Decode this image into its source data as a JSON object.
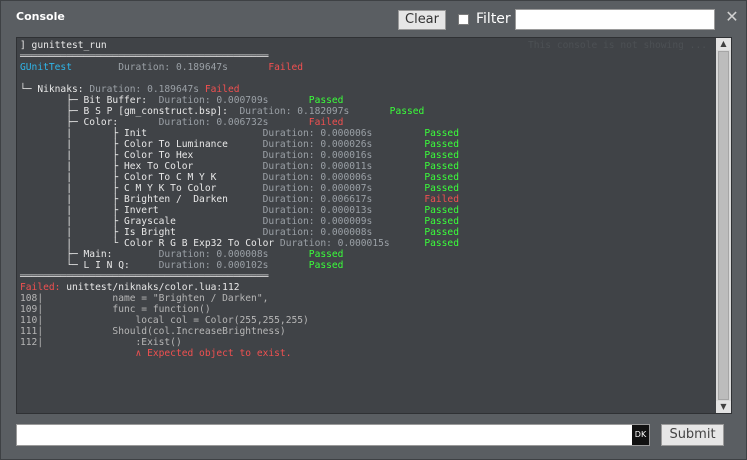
{
  "window": {
    "title": "Console",
    "close_glyph": "✕"
  },
  "toolbar": {
    "clear_label": "Clear",
    "filter_label": "Filter",
    "filter_value": "",
    "filter_checked": false
  },
  "console": {
    "ghost_text": "This console is not showing ...",
    "lines": [
      [
        {
          "t": "] gunittest_run",
          "c": "white"
        }
      ],
      [
        {
          "t": "═══════════════════════════════════════════",
          "c": "sep"
        }
      ],
      [
        {
          "t": "GUnitTest",
          "c": "cyan"
        },
        {
          "t": "        Duration: 0.189647s",
          "c": "gray"
        },
        {
          "t": "       Failed",
          "c": "failed"
        }
      ],
      [
        {
          "t": "",
          "c": "white"
        }
      ],
      [
        {
          "t": "└─ Niknaks: ",
          "c": "white"
        },
        {
          "t": "Duration: 0.189647s ",
          "c": "gray"
        },
        {
          "t": "Failed",
          "c": "failed"
        }
      ],
      [
        {
          "t": "        ├─ Bit Buffer:  ",
          "c": "white"
        },
        {
          "t": "Duration: 0.000709s",
          "c": "gray"
        },
        {
          "t": "       Passed",
          "c": "passed"
        }
      ],
      [
        {
          "t": "        ├─ B S P [gm_construct.bsp]:  ",
          "c": "white"
        },
        {
          "t": "Duration: 0.182097s",
          "c": "gray"
        },
        {
          "t": "       Passed",
          "c": "passed"
        }
      ],
      [
        {
          "t": "        ├─ Color:       ",
          "c": "white"
        },
        {
          "t": "Duration: 0.006732s",
          "c": "gray"
        },
        {
          "t": "       Failed",
          "c": "failed"
        }
      ],
      [
        {
          "t": "        |       ├ Init                    ",
          "c": "white"
        },
        {
          "t": "Duration: 0.000006s",
          "c": "gray"
        },
        {
          "t": "         Passed",
          "c": "passed"
        }
      ],
      [
        {
          "t": "        |       ├ Color To Luminance      ",
          "c": "white"
        },
        {
          "t": "Duration: 0.000026s",
          "c": "gray"
        },
        {
          "t": "         Passed",
          "c": "passed"
        }
      ],
      [
        {
          "t": "        |       ├ Color To Hex            ",
          "c": "white"
        },
        {
          "t": "Duration: 0.000016s",
          "c": "gray"
        },
        {
          "t": "         Passed",
          "c": "passed"
        }
      ],
      [
        {
          "t": "        |       ├ Hex To Color            ",
          "c": "white"
        },
        {
          "t": "Duration: 0.000011s",
          "c": "gray"
        },
        {
          "t": "         Passed",
          "c": "passed"
        }
      ],
      [
        {
          "t": "        |       ├ Color To C M Y K        ",
          "c": "white"
        },
        {
          "t": "Duration: 0.000006s",
          "c": "gray"
        },
        {
          "t": "         Passed",
          "c": "passed"
        }
      ],
      [
        {
          "t": "        |       ├ C M Y K To Color        ",
          "c": "white"
        },
        {
          "t": "Duration: 0.000007s",
          "c": "gray"
        },
        {
          "t": "         Passed",
          "c": "passed"
        }
      ],
      [
        {
          "t": "        |       ├ Brighten /  Darken      ",
          "c": "white"
        },
        {
          "t": "Duration: 0.006617s",
          "c": "gray"
        },
        {
          "t": "         Failed",
          "c": "failed"
        }
      ],
      [
        {
          "t": "        |       ├ Invert                  ",
          "c": "white"
        },
        {
          "t": "Duration: 0.000013s",
          "c": "gray"
        },
        {
          "t": "         Passed",
          "c": "passed"
        }
      ],
      [
        {
          "t": "        |       ├ Grayscale               ",
          "c": "white"
        },
        {
          "t": "Duration: 0.000009s",
          "c": "gray"
        },
        {
          "t": "         Passed",
          "c": "passed"
        }
      ],
      [
        {
          "t": "        |       ├ Is Bright               ",
          "c": "white"
        },
        {
          "t": "Duration: 0.000008s",
          "c": "gray"
        },
        {
          "t": "         Passed",
          "c": "passed"
        }
      ],
      [
        {
          "t": "        |       └ Color R G B Exp32 To Color ",
          "c": "white"
        },
        {
          "t": "Duration: 0.000015s",
          "c": "gray"
        },
        {
          "t": "      Passed",
          "c": "passed"
        }
      ],
      [
        {
          "t": "        ├─ Main:        ",
          "c": "white"
        },
        {
          "t": "Duration: 0.000008s",
          "c": "gray"
        },
        {
          "t": "       Passed",
          "c": "passed"
        }
      ],
      [
        {
          "t": "        └─ L I N Q:     ",
          "c": "white"
        },
        {
          "t": "Duration: 0.000102s",
          "c": "gray"
        },
        {
          "t": "       Passed",
          "c": "passed"
        }
      ],
      [
        {
          "t": "═══════════════════════════════════════════",
          "c": "sep"
        }
      ],
      [
        {
          "t": "Failed: ",
          "c": "failed"
        },
        {
          "t": "unittest/niknaks/color.lua:112",
          "c": "white"
        }
      ],
      [
        {
          "t": "108|            name = \"Brighten / Darken\",",
          "c": "dim"
        }
      ],
      [
        {
          "t": "109|            func = function()",
          "c": "dim"
        }
      ],
      [
        {
          "t": "110|                local col = Color(255,255,255)",
          "c": "dim"
        }
      ],
      [
        {
          "t": "111|            Should(col.IncreaseBrightness)",
          "c": "dim"
        }
      ],
      [
        {
          "t": "112|                :Exist()",
          "c": "dim"
        }
      ],
      [
        {
          "t": "                    ∧ Expected object to exist.",
          "c": "failed"
        }
      ]
    ]
  },
  "scrollbar": {
    "up_glyph": "▲",
    "down_glyph": "▼"
  },
  "command": {
    "value": "",
    "badge": "DK",
    "submit_label": "Submit"
  }
}
